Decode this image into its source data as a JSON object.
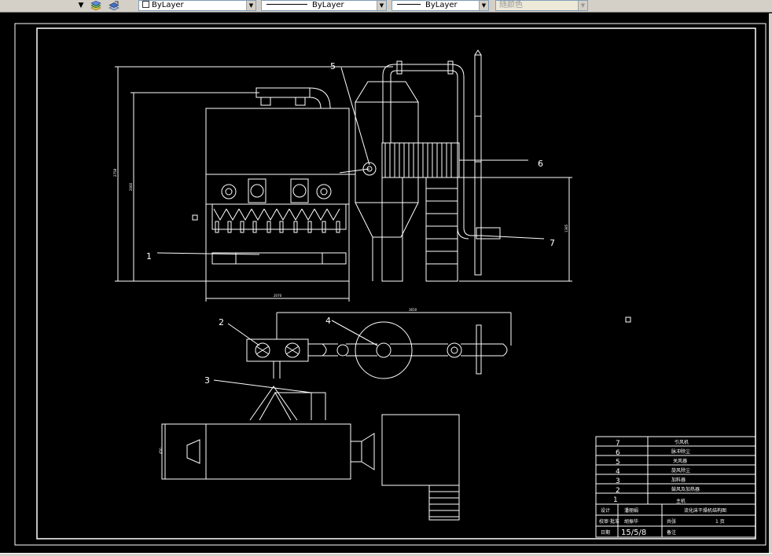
{
  "toolbar": {
    "layer_tools": [
      "layer-states-icon",
      "layer-previous-icon"
    ],
    "color_combo": {
      "value": "ByLayer"
    },
    "linetype_combo": {
      "value": "ByLayer"
    },
    "lineweight_combo": {
      "value": "ByLayer"
    },
    "plotstyle_combo": {
      "value": "随颜色"
    }
  },
  "drawing": {
    "callouts": [
      "1",
      "2",
      "3",
      "4",
      "5",
      "6",
      "7"
    ],
    "dimensions": {
      "overall_height": "2758",
      "body_height": "2060",
      "dryer_width": "2070",
      "bottom_height": "1385",
      "separator_height": "1100",
      "plan_width": "3650",
      "burner_height": "450"
    },
    "title_block": {
      "parts": [
        {
          "no": "7",
          "name": "引风机"
        },
        {
          "no": "6",
          "name": "脉冲除尘"
        },
        {
          "no": "5",
          "name": "关风器"
        },
        {
          "no": "4",
          "name": "旋风除尘"
        },
        {
          "no": "3",
          "name": "加料器"
        },
        {
          "no": "2",
          "name": "鼓风及加热器"
        },
        {
          "no": "1",
          "name": "主机"
        }
      ],
      "labels": {
        "designer": "设计",
        "designer_name": "潘丽娟",
        "drawing_title": "流化床干燥机结构图",
        "checker": "校审·批准",
        "checker_name": "胡振华",
        "sheets_label": "共张",
        "sheets_value": "1 页",
        "date_label": "日期",
        "date_value": "15/5/8",
        "remark": "备注"
      }
    }
  },
  "colors": {
    "background": "#000000",
    "lines": "#ffffff",
    "toolbar": "#d4d0c8"
  }
}
